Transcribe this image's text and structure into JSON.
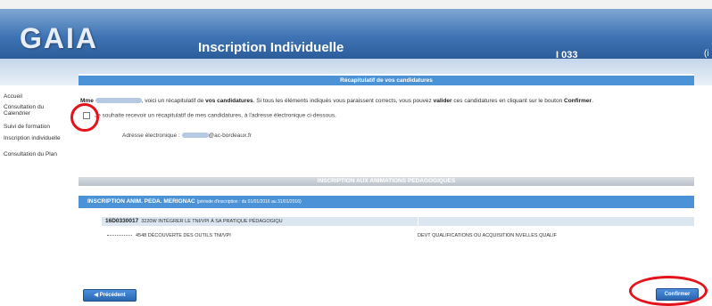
{
  "header": {
    "logo": "GAIA",
    "title": "Inscription Individuelle",
    "code": "I 033",
    "user_glyph": "(i"
  },
  "sidebar": {
    "items": [
      {
        "label": "Accueil"
      },
      {
        "label": "Consultation du Calendrier"
      },
      {
        "label": "Suivi de formation"
      },
      {
        "label": "Inscription individuelle"
      },
      {
        "label": "Consultation du Plan"
      }
    ]
  },
  "main": {
    "summary_title": "Récapitulatif de vos candidatures",
    "intro": {
      "greeting": "Mme",
      "text1": ", voici un récapitulatif de",
      "bold1": "vos candidatures",
      "text2": ". Si tous les éléments indiqués vous paraissent corrects, vous pouvez",
      "bold2": "valider",
      "text3": "ces candidatures en cliquant sur le bouton",
      "bold3": "Confirmer",
      "end": "."
    },
    "checkbox_label": "Je souhaite recevoir un récapitulatif de mes candidatures, à l'adresse électronique ci-dessous.",
    "email_label": "Adresse électronique :",
    "email_domain": "@ac-bordeaux.fr",
    "section_title": "INSCRIPTION AUX ANIMATIONS PEDAGOGIQUES",
    "sub_section": {
      "title": "INSCRIPTION ANIM. PEDA. MERIGNAC",
      "period": "(période d'inscription : du 01/01/2016 au 31/01/2016)"
    },
    "module": {
      "code": "16D0330017",
      "title": "3220W INTÉGRER LE TNI/VPI À SA PRATIQUE PÉDAGOGIQU"
    },
    "sub_module": {
      "title": "4548 DÉCOUVERTE DES OUTILS TNI/VPI",
      "category": "DEVT QUALIFICATIONS OU ACQUISITION NVELLES QUALIF"
    }
  },
  "buttons": {
    "previous": "◀ Précédent",
    "confirm": "Confirmer"
  },
  "colors": {
    "accent": "#4b92d6",
    "annotation": "#e3131b"
  }
}
